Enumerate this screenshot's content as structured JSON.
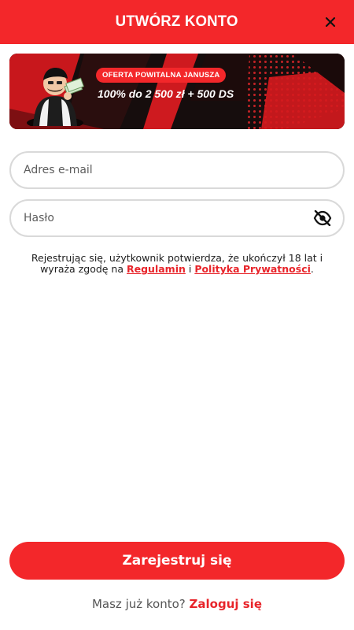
{
  "header": {
    "title": "UTWÓRZ KONTO",
    "close_icon": "close-icon"
  },
  "banner": {
    "badge": "OFERTA POWITALNA JANUSZA",
    "headline": "100% do 2 500 zł + 500 DS",
    "mascot_icon": "mascot-illustration"
  },
  "form": {
    "email_placeholder": "Adres e-mail",
    "password_placeholder": "Hasło",
    "password_toggle_icon": "eye-slash-icon"
  },
  "terms": {
    "text_before": "Rejestrując się, użytkownik potwierdza, że ukończył 18 lat i wyraża zgodę na ",
    "link_terms": "Regulamin",
    "connector": " i ",
    "link_privacy": "Polityka Prywatności",
    "text_after": "."
  },
  "actions": {
    "submit_label": "Zarejestruj się",
    "login_prompt": "Masz już konto?",
    "login_link": "Zaloguj się"
  },
  "colors": {
    "brand_red": "#f3272a",
    "link_red": "#e8242a",
    "field_border": "#d9d9d9"
  }
}
